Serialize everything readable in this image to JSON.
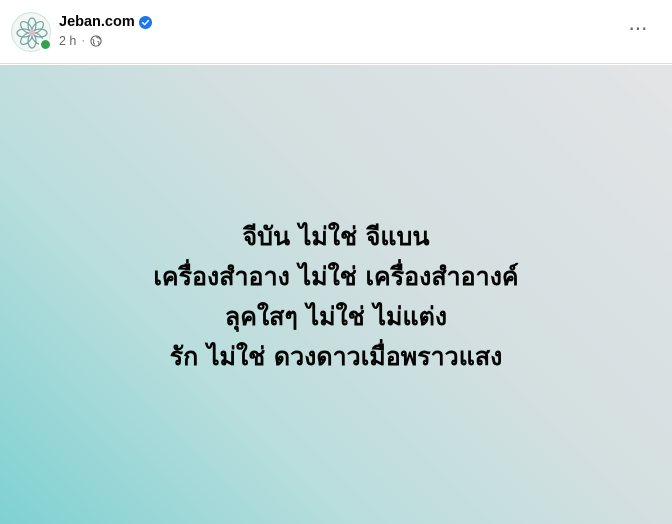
{
  "post": {
    "page_name": "Jeban.com",
    "verified": true,
    "timestamp": "2 h",
    "separator": "·",
    "audience_icon": "globe-icon",
    "more_icon": "more-options-icon",
    "more_label": "···",
    "lines": [
      "จีบัน ไม่ใช่ จีแบน",
      "เครื่องสำอาง ไม่ใช่ เครื่องสำอางค์",
      "ลุคใสๆ ไม่ใช่ ไม่แต่ง",
      "รัก ไม่ใช่ ดวงดาวเมื่อพราวแสง"
    ]
  },
  "colors": {
    "verified_blue": "#1877f2",
    "online_green": "#31a24c",
    "background_gradient_start": "#7fd1d2",
    "background_gradient_end": "#e3e4e6"
  }
}
